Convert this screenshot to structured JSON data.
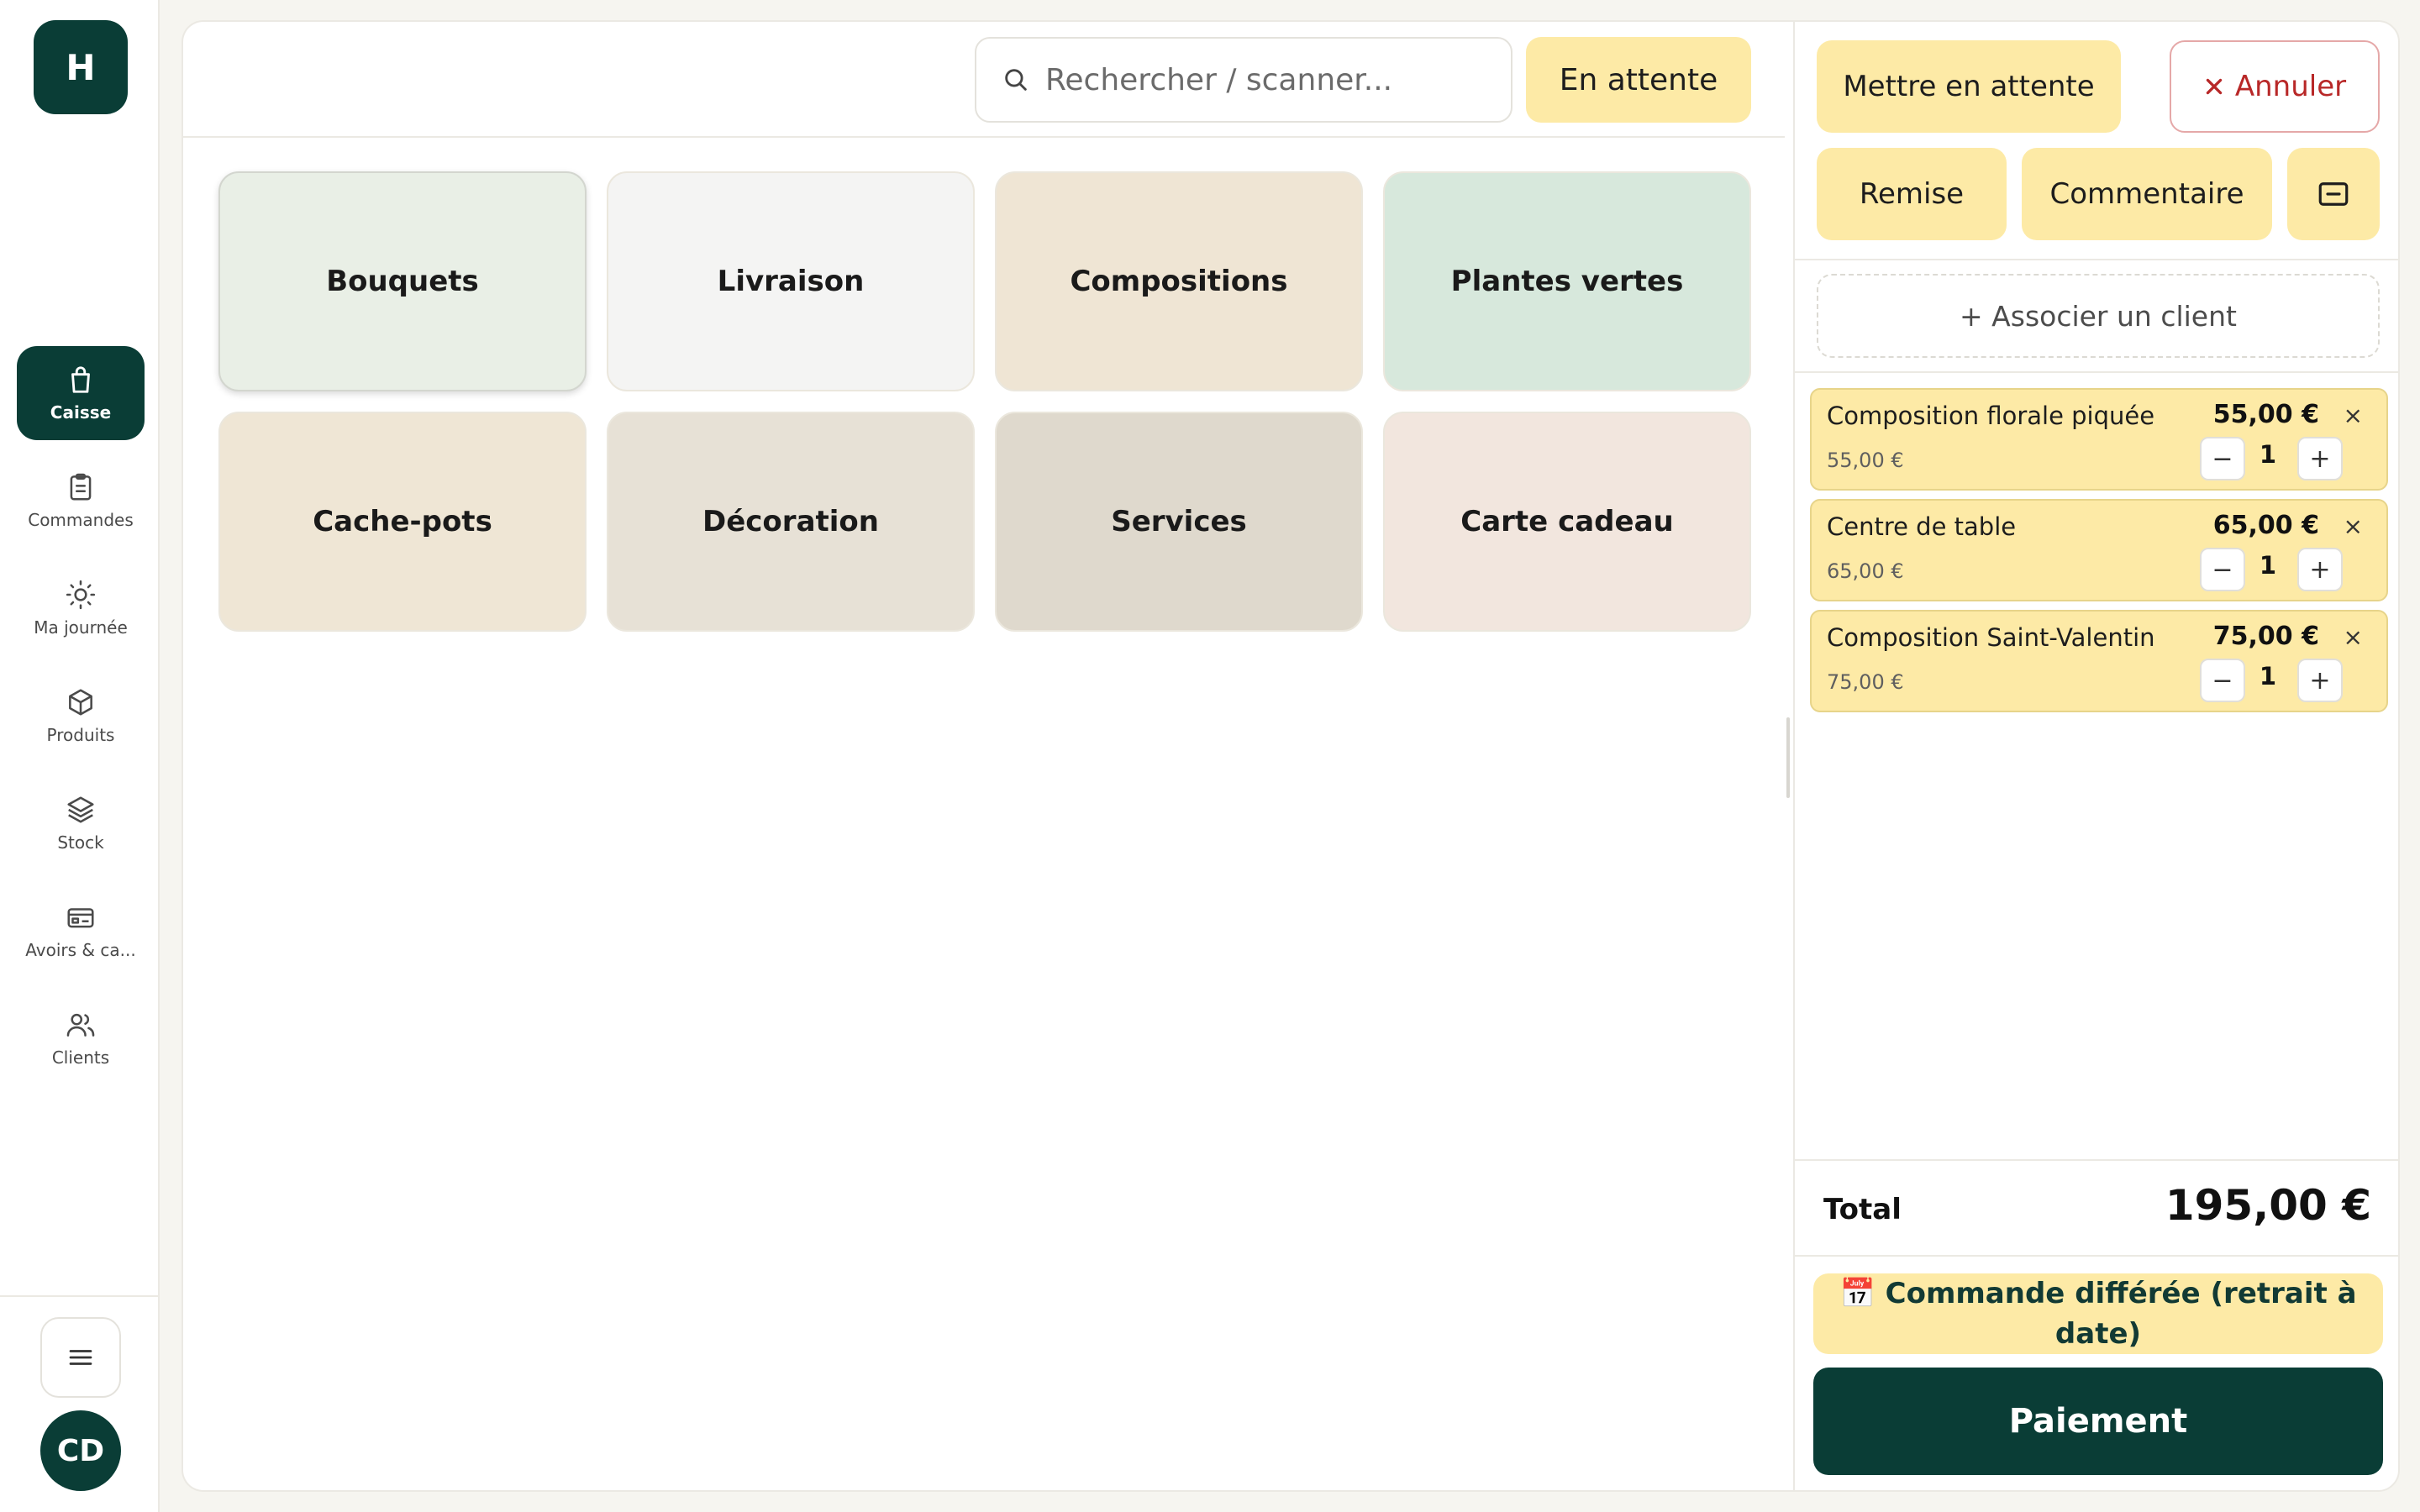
{
  "app": {
    "logo_letter": "H",
    "user_initials": "CD"
  },
  "sidebar": {
    "items": [
      {
        "label": "Caisse",
        "icon": "shopping-bag-icon",
        "active": true
      },
      {
        "label": "Commandes",
        "icon": "clipboard-icon"
      },
      {
        "label": "Ma journée",
        "icon": "sun-icon"
      },
      {
        "label": "Produits",
        "icon": "box-icon"
      },
      {
        "label": "Stock",
        "icon": "layers-icon"
      },
      {
        "label": "Avoirs & ca...",
        "icon": "card-icon"
      },
      {
        "label": "Clients",
        "icon": "users-icon"
      }
    ],
    "menu_icon": "hamburger-icon"
  },
  "search": {
    "placeholder": "Rechercher / scanner..."
  },
  "header": {
    "waiting_label": "En attente"
  },
  "categories": [
    {
      "label": "Bouquets",
      "color": "#e9efe6"
    },
    {
      "label": "Livraison",
      "color": "#f4f4f3"
    },
    {
      "label": "Compositions",
      "color": "#efe5d4"
    },
    {
      "label": "Plantes vertes",
      "color": "#d7e8dc"
    },
    {
      "label": "Cache-pots",
      "color": "#efe6d5"
    },
    {
      "label": "Décoration",
      "color": "#e7e1d6"
    },
    {
      "label": "Services",
      "color": "#dfd9cd"
    },
    {
      "label": "Carte cadeau",
      "color": "#f2e6de"
    }
  ],
  "cart": {
    "hold_label": "Mettre en attente",
    "cancel_label": "Annuler",
    "discount_label": "Remise",
    "comment_label": "Commentaire",
    "associate_client_label": "+ Associer un client",
    "items": [
      {
        "name": "Composition florale piquée",
        "unit_price": "55,00 €",
        "line_total": "55,00 €",
        "qty": "1"
      },
      {
        "name": "Centre de table",
        "unit_price": "65,00 €",
        "line_total": "65,00 €",
        "qty": "1"
      },
      {
        "name": "Composition Saint-Valentin",
        "unit_price": "75,00 €",
        "line_total": "75,00 €",
        "qty": "1"
      }
    ],
    "remove_glyph": "×",
    "minus_glyph": "−",
    "plus_glyph": "+",
    "total_label": "Total",
    "total_value": "195,00 €",
    "deferred_label": "📅 Commande différée (retrait à date)",
    "pay_label": "Paiement"
  },
  "colors": {
    "brand": "#0a3d36",
    "accent_yellow": "#fdeaa6",
    "cancel_red": "#b82828"
  }
}
